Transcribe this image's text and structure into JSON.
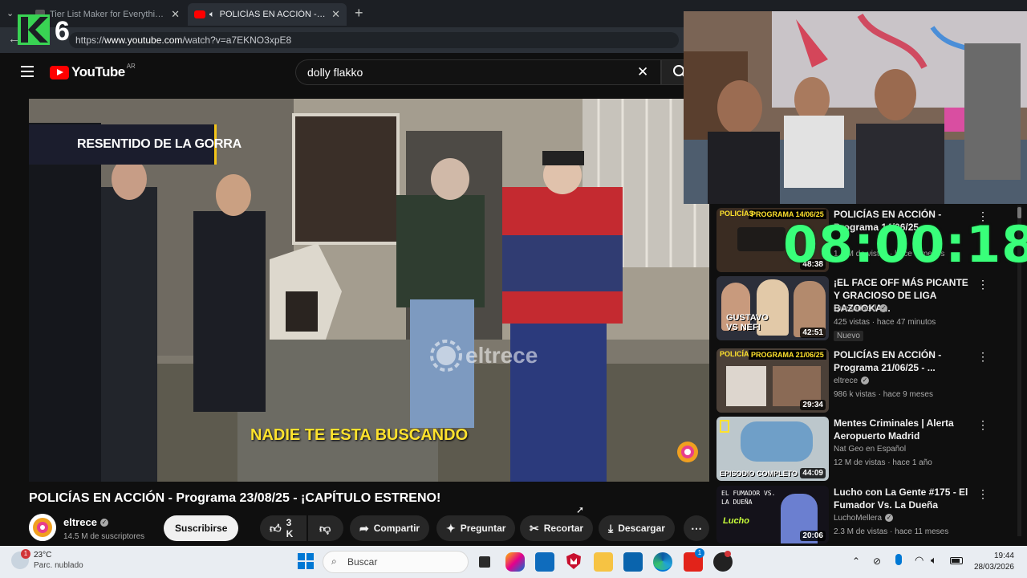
{
  "browser": {
    "tabs": [
      {
        "title": "Tier List Maker for Everything - Tier",
        "active": false
      },
      {
        "title": "POLICÍAS EN ACCIÓN - Programa",
        "active": true
      }
    ],
    "url_prefix": "https://",
    "url_host": "www.youtube.com",
    "url_path": "/watch?v=a7EKNO3xpE8"
  },
  "overlay": {
    "k6_label": "6",
    "timer": "08:00:18"
  },
  "youtube": {
    "logo_text": "YouTube",
    "region": "AR",
    "search_value": "dolly flakko",
    "video": {
      "banner": "RESENTIDO DE LA GORRA",
      "subtitle": "NADIE TE ESTA BUSCANDO",
      "watermark": "eltrece",
      "title": "POLICÍAS EN ACCIÓN - Programa 23/08/25 - ¡CAPÍTULO ESTRENO!",
      "channel": "eltrece",
      "subscribers": "14.5 M de suscriptores",
      "subscribe_label": "Suscribirse",
      "likes": "3 K",
      "share_label": "Compartir",
      "ask_label": "Preguntar",
      "clip_label": "Recortar",
      "download_label": "Descargar"
    },
    "recommendations": [
      {
        "title": "POLICÍAS EN ACCIÓN - Programa 14/06/25...",
        "thumb_caption": "PROGRAMA 14/06/25",
        "channel": "",
        "meta": "1.1 M de vistas · hace 9 meses",
        "duration": "48:38",
        "badge": ""
      },
      {
        "title": "¡EL FACE OFF MÁS PICANTE Y GRACIOSO DE LIGA BAZOOKA...",
        "thumb_caption": "GUSTAVO VS NEFI",
        "channel": "Quesadacid",
        "meta": "425 vistas · hace 47 minutos",
        "duration": "42:51",
        "badge": "Nuevo"
      },
      {
        "title": "POLICÍAS EN ACCIÓN - Programa 21/06/25 - ...",
        "thumb_caption": "PROGRAMA 21/06/25",
        "channel": "eltrece",
        "meta": "986 k vistas · hace 9 meses",
        "duration": "29:34",
        "badge": ""
      },
      {
        "title": "Mentes Criminales | Alerta Aeropuerto Madrid",
        "thumb_caption": "EPISODIO COMPLETO",
        "channel": "Nat Geo en Español",
        "meta": "12 M de vistas · hace 1 año",
        "duration": "44:09",
        "badge": ""
      },
      {
        "title": "Lucho con La Gente #175 - El Fumador Vs. La Dueña",
        "thumb_caption": "EL FUMADOR VS. LA DUEÑA",
        "channel": "LuchoMellera",
        "meta": "2.3 M de vistas · hace 11 meses",
        "duration": "20:06",
        "badge": ""
      }
    ]
  },
  "taskbar": {
    "weather_temp": "23°C",
    "weather_desc": "Parc. nublado",
    "search_placeholder": "Buscar",
    "time": "19:44",
    "date": "28/03/2026"
  },
  "colors": {
    "yt_red": "#ff0000",
    "timer_green": "#39ff7a",
    "k6_green": "#39d353"
  }
}
